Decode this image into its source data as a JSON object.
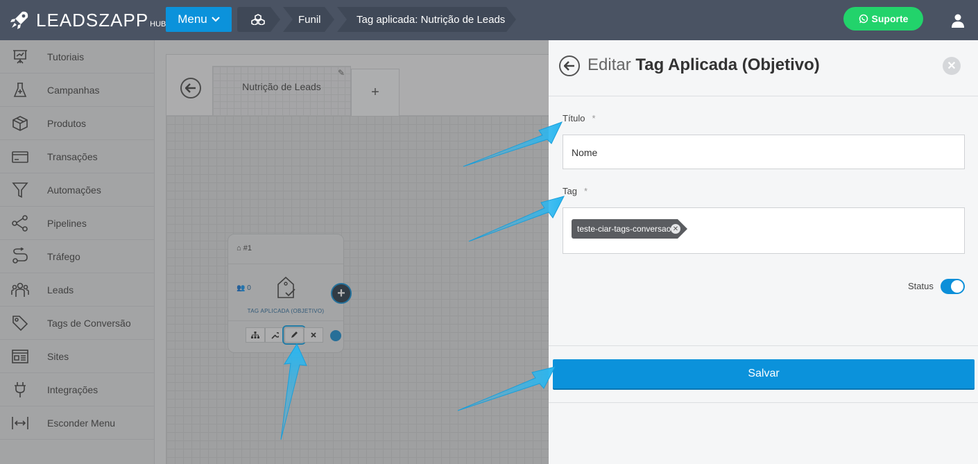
{
  "header": {
    "brand": "LEADSZAPP",
    "brand_suffix": "HUB",
    "menu_label": "Menu",
    "breadcrumbs": [
      "Funil",
      "Tag aplicada: Nutrição de Leads"
    ],
    "support_label": "Suporte"
  },
  "sidebar": {
    "items": [
      {
        "label": "Tutoriais",
        "icon": "presentation-icon"
      },
      {
        "label": "Campanhas",
        "icon": "flask-icon"
      },
      {
        "label": "Produtos",
        "icon": "box-icon"
      },
      {
        "label": "Transações",
        "icon": "credit-card-icon"
      },
      {
        "label": "Automações",
        "icon": "funnel-icon"
      },
      {
        "label": "Pipelines",
        "icon": "share-icon"
      },
      {
        "label": "Tráfego",
        "icon": "route-icon"
      },
      {
        "label": "Leads",
        "icon": "users-icon"
      },
      {
        "label": "Tags de Conversão",
        "icon": "tag-icon"
      },
      {
        "label": "Sites",
        "icon": "website-icon"
      },
      {
        "label": "Integrações",
        "icon": "plug-icon"
      },
      {
        "label": "Esconder Menu",
        "icon": "collapse-icon"
      }
    ]
  },
  "workspace": {
    "tab_label": "Nutrição de Leads",
    "add_tab": "+",
    "node": {
      "id": "#1",
      "count": "0",
      "title": "TAG APLICADA (OBJETIVO)",
      "add": "+"
    }
  },
  "panel": {
    "title_prefix": "Editar",
    "title_bold": "Tag Aplicada (Objetivo)",
    "titulo_label": "Título",
    "titulo_value": "Nome",
    "tag_label": "Tag",
    "required_mark": "*",
    "tag_chip": "teste-ciar-tags-conversao",
    "status_label": "Status",
    "status_on": true,
    "save_label": "Salvar"
  },
  "colors": {
    "topbar": "#4a5363",
    "accent": "#0b92db",
    "support": "#22d36b"
  }
}
